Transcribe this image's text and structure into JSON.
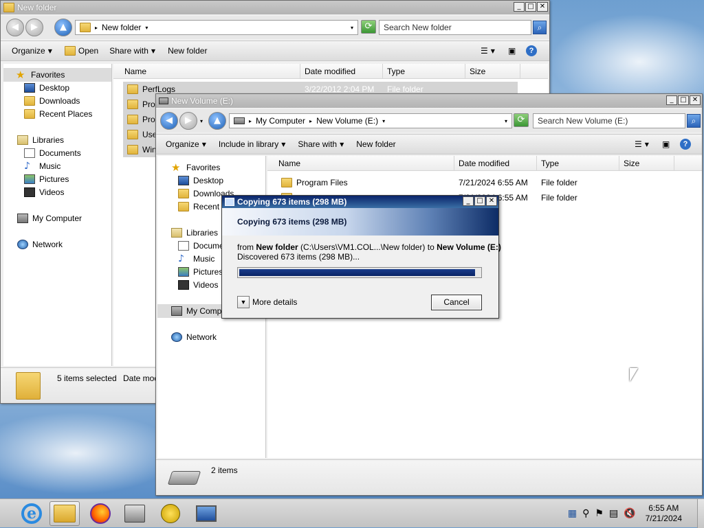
{
  "window1": {
    "title": "New folder",
    "address": "New folder",
    "search_placeholder": "Search New folder",
    "commands": [
      "Organize",
      "Open",
      "Share with",
      "New folder"
    ],
    "nav": {
      "favorites": "Favorites",
      "fav_items": [
        "Desktop",
        "Downloads",
        "Recent Places"
      ],
      "libraries": "Libraries",
      "lib_items": [
        "Documents",
        "Music",
        "Pictures",
        "Videos"
      ],
      "computer": "My Computer",
      "network": "Network"
    },
    "columns": [
      "Name",
      "Date modified",
      "Type",
      "Size"
    ],
    "files": [
      {
        "name": "PerfLogs",
        "date": "3/22/2012 2:04 PM",
        "type": "File folder"
      },
      {
        "name": "Progr",
        "date": "",
        "type": ""
      },
      {
        "name": "Progr",
        "date": "",
        "type": ""
      },
      {
        "name": "Users",
        "date": "",
        "type": ""
      },
      {
        "name": "Windc",
        "date": "",
        "type": ""
      }
    ],
    "status": "5 items selected",
    "status_extra": "Date mod"
  },
  "window2": {
    "title": "New Volume (E:)",
    "breadcrumb": [
      "My Computer",
      "New Volume (E:)"
    ],
    "search_placeholder": "Search New Volume (E:)",
    "commands": [
      "Organize",
      "Include in library",
      "Share with",
      "New folder"
    ],
    "nav": {
      "favorites": "Favorites",
      "fav_items": [
        "Desktop",
        "Downloads",
        "Recent Places"
      ],
      "libraries": "Libraries",
      "lib_items": [
        "Documents",
        "Music",
        "Pictures",
        "Videos"
      ],
      "computer": "My Computer",
      "network": "Network"
    },
    "columns": [
      "Name",
      "Date modified",
      "Type",
      "Size"
    ],
    "files": [
      {
        "name": "Program Files",
        "date": "7/21/2024 6:55 AM",
        "type": "File folder"
      },
      {
        "name": "",
        "date": "7/21/2024 6:55 AM",
        "type": "File folder"
      }
    ],
    "status": "2 items"
  },
  "dialog": {
    "title": "Copying 673 items (298 MB)",
    "heading": "Copying 673 items (298 MB)",
    "from_label": "from",
    "source": "New folder",
    "source_path": "(C:\\Users\\VM1.COL...\\New folder)",
    "to_label": "to",
    "destination": "New Volume (E:)",
    "discovered": "Discovered 673 items (298 MB)...",
    "progress": 0.98,
    "more_details": "More details",
    "cancel": "Cancel"
  },
  "taskbar": {
    "apps": [
      "internet-explorer",
      "windows-explorer",
      "firefox",
      "server-manager",
      "tool",
      "remote-desktop"
    ],
    "time": "6:55 AM",
    "date": "7/21/2024"
  }
}
